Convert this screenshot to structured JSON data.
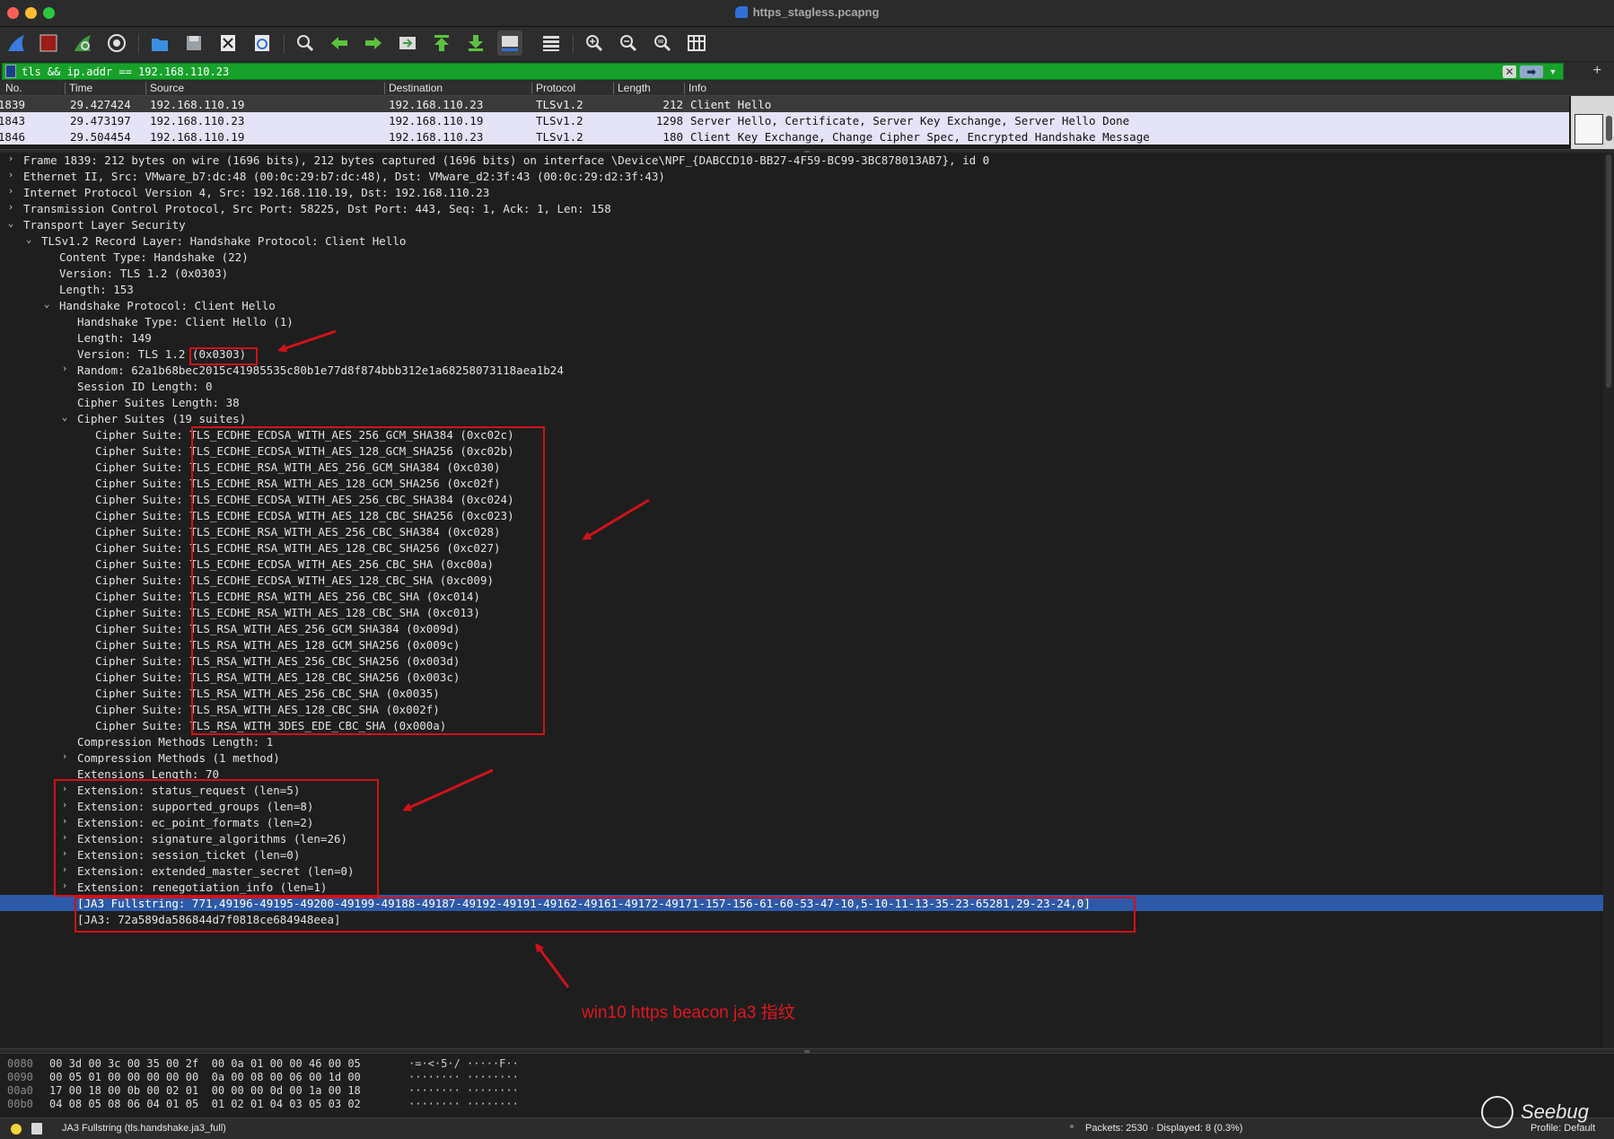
{
  "window": {
    "title": "https_stagless.pcapng"
  },
  "toolbar": {
    "buttons": [
      "shark-fin-icon",
      "stop-capture-icon",
      "restart-capture-icon",
      "capture-options-icon",
      "open-file-icon",
      "save-file-icon",
      "close-file-icon",
      "reload-file-icon",
      "find-packet-icon",
      "go-back-icon",
      "go-forward-icon",
      "go-to-packet-icon",
      "first-packet-icon",
      "last-packet-icon",
      "autoscroll-icon",
      "colorize-icon",
      "zoom-in-icon",
      "zoom-out-icon",
      "normal-size-icon",
      "resize-columns-icon"
    ]
  },
  "filter": {
    "value": "tls && ip.addr == 192.168.110.23",
    "clear": "✕",
    "apply": "➡",
    "add": "+"
  },
  "packet_list": {
    "columns": [
      "No.",
      "Time",
      "Source",
      "Destination",
      "Protocol",
      "Length",
      "Info"
    ],
    "rows": [
      {
        "no": "1839",
        "time": "29.427424",
        "src": "192.168.110.19",
        "dst": "192.168.110.23",
        "proto": "TLSv1.2",
        "len": "212",
        "info": "Client Hello"
      },
      {
        "no": "1843",
        "time": "29.473197",
        "src": "192.168.110.23",
        "dst": "192.168.110.19",
        "proto": "TLSv1.2",
        "len": "1298",
        "info": "Server Hello, Certificate, Server Key Exchange, Server Hello Done"
      },
      {
        "no": "1846",
        "time": "29.504454",
        "src": "192.168.110.19",
        "dst": "192.168.110.23",
        "proto": "TLSv1.2",
        "len": "180",
        "info": "Client Key Exchange, Change Cipher Spec, Encrypted Handshake Message"
      }
    ]
  },
  "details": [
    {
      "t": "Frame 1839: 212 bytes on wire (1696 bits), 212 bytes captured (1696 bits) on interface \\Device\\NPF_{DABCCD10-BB27-4F59-BC99-3BC878013AB7}, id 0",
      "d": 0,
      "e": "›"
    },
    {
      "t": "Ethernet II, Src: VMware_b7:dc:48 (00:0c:29:b7:dc:48), Dst: VMware_d2:3f:43 (00:0c:29:d2:3f:43)",
      "d": 0,
      "e": "›"
    },
    {
      "t": "Internet Protocol Version 4, Src: 192.168.110.19, Dst: 192.168.110.23",
      "d": 0,
      "e": "›"
    },
    {
      "t": "Transmission Control Protocol, Src Port: 58225, Dst Port: 443, Seq: 1, Ack: 1, Len: 158",
      "d": 0,
      "e": "›"
    },
    {
      "t": "Transport Layer Security",
      "d": 0,
      "e": "⌄"
    },
    {
      "t": "TLSv1.2 Record Layer: Handshake Protocol: Client Hello",
      "d": 1,
      "e": "⌄"
    },
    {
      "t": "Content Type: Handshake (22)",
      "d": 2,
      "e": ""
    },
    {
      "t": "Version: TLS 1.2 (0x0303)",
      "d": 2,
      "e": ""
    },
    {
      "t": "Length: 153",
      "d": 2,
      "e": ""
    },
    {
      "t": "Handshake Protocol: Client Hello",
      "d": 2,
      "e": "⌄"
    },
    {
      "t": "Handshake Type: Client Hello (1)",
      "d": 3,
      "e": ""
    },
    {
      "t": "Length: 149",
      "d": 3,
      "e": ""
    },
    {
      "t": "Version: TLS 1.2 (0x0303)",
      "d": 3,
      "e": ""
    },
    {
      "t": "Random: 62a1b68bec2015c41985535c80b1e77d8f874bbb312e1a68258073118aea1b24",
      "d": 3,
      "e": "›"
    },
    {
      "t": "Session ID Length: 0",
      "d": 3,
      "e": ""
    },
    {
      "t": "Cipher Suites Length: 38",
      "d": 3,
      "e": ""
    },
    {
      "t": "Cipher Suites (19 suites)",
      "d": 3,
      "e": "⌄"
    },
    {
      "t": "Cipher Suite: TLS_ECDHE_ECDSA_WITH_AES_256_GCM_SHA384 (0xc02c)",
      "d": 4,
      "e": ""
    },
    {
      "t": "Cipher Suite: TLS_ECDHE_ECDSA_WITH_AES_128_GCM_SHA256 (0xc02b)",
      "d": 4,
      "e": ""
    },
    {
      "t": "Cipher Suite: TLS_ECDHE_RSA_WITH_AES_256_GCM_SHA384 (0xc030)",
      "d": 4,
      "e": ""
    },
    {
      "t": "Cipher Suite: TLS_ECDHE_RSA_WITH_AES_128_GCM_SHA256 (0xc02f)",
      "d": 4,
      "e": ""
    },
    {
      "t": "Cipher Suite: TLS_ECDHE_ECDSA_WITH_AES_256_CBC_SHA384 (0xc024)",
      "d": 4,
      "e": ""
    },
    {
      "t": "Cipher Suite: TLS_ECDHE_ECDSA_WITH_AES_128_CBC_SHA256 (0xc023)",
      "d": 4,
      "e": ""
    },
    {
      "t": "Cipher Suite: TLS_ECDHE_RSA_WITH_AES_256_CBC_SHA384 (0xc028)",
      "d": 4,
      "e": ""
    },
    {
      "t": "Cipher Suite: TLS_ECDHE_RSA_WITH_AES_128_CBC_SHA256 (0xc027)",
      "d": 4,
      "e": ""
    },
    {
      "t": "Cipher Suite: TLS_ECDHE_ECDSA_WITH_AES_256_CBC_SHA (0xc00a)",
      "d": 4,
      "e": ""
    },
    {
      "t": "Cipher Suite: TLS_ECDHE_ECDSA_WITH_AES_128_CBC_SHA (0xc009)",
      "d": 4,
      "e": ""
    },
    {
      "t": "Cipher Suite: TLS_ECDHE_RSA_WITH_AES_256_CBC_SHA (0xc014)",
      "d": 4,
      "e": ""
    },
    {
      "t": "Cipher Suite: TLS_ECDHE_RSA_WITH_AES_128_CBC_SHA (0xc013)",
      "d": 4,
      "e": ""
    },
    {
      "t": "Cipher Suite: TLS_RSA_WITH_AES_256_GCM_SHA384 (0x009d)",
      "d": 4,
      "e": ""
    },
    {
      "t": "Cipher Suite: TLS_RSA_WITH_AES_128_GCM_SHA256 (0x009c)",
      "d": 4,
      "e": ""
    },
    {
      "t": "Cipher Suite: TLS_RSA_WITH_AES_256_CBC_SHA256 (0x003d)",
      "d": 4,
      "e": ""
    },
    {
      "t": "Cipher Suite: TLS_RSA_WITH_AES_128_CBC_SHA256 (0x003c)",
      "d": 4,
      "e": ""
    },
    {
      "t": "Cipher Suite: TLS_RSA_WITH_AES_256_CBC_SHA (0x0035)",
      "d": 4,
      "e": ""
    },
    {
      "t": "Cipher Suite: TLS_RSA_WITH_AES_128_CBC_SHA (0x002f)",
      "d": 4,
      "e": ""
    },
    {
      "t": "Cipher Suite: TLS_RSA_WITH_3DES_EDE_CBC_SHA (0x000a)",
      "d": 4,
      "e": ""
    },
    {
      "t": "Compression Methods Length: 1",
      "d": 3,
      "e": ""
    },
    {
      "t": "Compression Methods (1 method)",
      "d": 3,
      "e": "›"
    },
    {
      "t": "Extensions Length: 70",
      "d": 3,
      "e": ""
    },
    {
      "t": "Extension: status_request (len=5)",
      "d": 3,
      "e": "›"
    },
    {
      "t": "Extension: supported_groups (len=8)",
      "d": 3,
      "e": "›"
    },
    {
      "t": "Extension: ec_point_formats (len=2)",
      "d": 3,
      "e": "›"
    },
    {
      "t": "Extension: signature_algorithms (len=26)",
      "d": 3,
      "e": "›"
    },
    {
      "t": "Extension: session_ticket (len=0)",
      "d": 3,
      "e": "›"
    },
    {
      "t": "Extension: extended_master_secret (len=0)",
      "d": 3,
      "e": "›"
    },
    {
      "t": "Extension: renegotiation_info (len=1)",
      "d": 3,
      "e": "›"
    },
    {
      "t": "[JA3 Fullstring: 771,49196-49195-49200-49199-49188-49187-49192-49191-49162-49161-49172-49171-157-156-61-60-53-47-10,5-10-11-13-35-23-65281,29-23-24,0]",
      "d": 3,
      "e": "",
      "sel": true
    },
    {
      "t": "[JA3: 72a589da586844d7f0818ce684948eea]",
      "d": 3,
      "e": ""
    }
  ],
  "annotation": {
    "caption": "win10 https beacon ja3 指纹",
    "color": "#d0121b"
  },
  "bytes": [
    {
      "off": "0080",
      "hex": "00 3d 00 3c 00 35 00 2f  00 0a 01 00 00 46 00 05",
      "asc": "·=·<·5·/ ·····F··"
    },
    {
      "off": "0090",
      "hex": "00 05 01 00 00 00 00 00  0a 00 08 00 06 00 1d 00",
      "asc": "········ ········"
    },
    {
      "off": "00a0",
      "hex": "17 00 18 00 0b 00 02 01  00 00 00 0d 00 1a 00 18",
      "asc": "········ ········"
    },
    {
      "off": "00b0",
      "hex": "04 08 05 08 06 04 01 05  01 02 01 04 03 05 03 02",
      "asc": "········ ········"
    }
  ],
  "status": {
    "field": "JA3 Fullstring (tls.handshake.ja3_full)",
    "packets": "Packets: 2530 · Displayed: 8 (0.3%)",
    "profile": "Profile: Default"
  },
  "watermark": {
    "text": "Seebug"
  }
}
